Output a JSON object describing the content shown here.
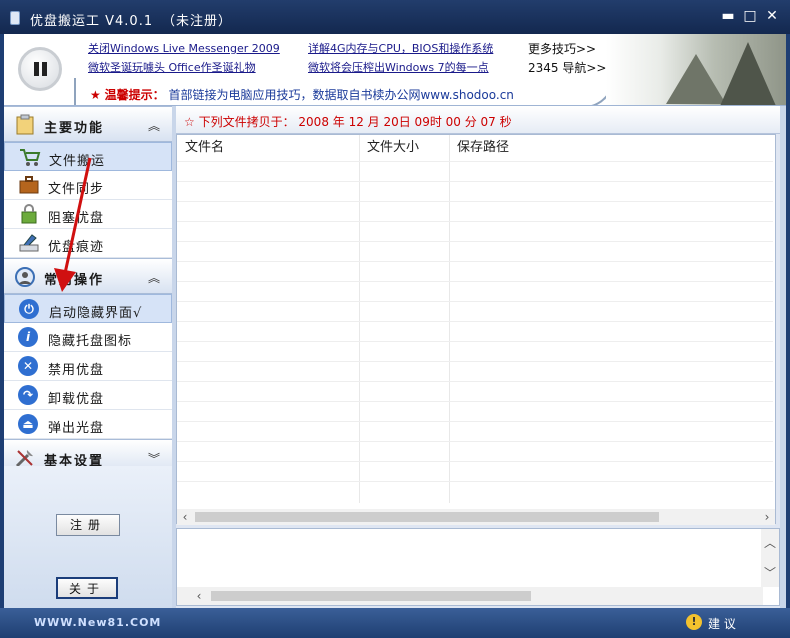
{
  "window": {
    "title": "优盘搬运工 V4.0.1",
    "registration_status": "（未注册）",
    "controls": {
      "minimize": "▬",
      "maximize": "□",
      "close": "✕"
    }
  },
  "banner": {
    "links_col1": [
      "关闭Windows Live Messenger 2009",
      "微软圣诞玩噱头 Office作圣诞礼物"
    ],
    "links_col2": [
      "详解4G内存与CPU，BIOS和操作系统",
      "微软将会压榨出Windows 7的每一点"
    ],
    "links_col3": [
      "更多技巧>>",
      "2345 导航>>"
    ],
    "tip_star": "★",
    "tip_label": "温馨提示：",
    "tip_text": "首部链接为电脑应用技巧，数据取自书椟办公网www.shodoo.cn"
  },
  "sidebar": {
    "section_main": {
      "label": "主要功能",
      "chevron": "︽"
    },
    "main_items": [
      "文件搬运",
      "文件同步",
      "阻塞优盘",
      "优盘痕迹"
    ],
    "section_ops": {
      "label": "常用操作",
      "chevron": "︽"
    },
    "ops_items": [
      "启动隐藏界面√",
      "隐藏托盘图标",
      "禁用优盘",
      "卸载优盘",
      "弹出光盘"
    ],
    "section_settings": {
      "label": "基本设置",
      "chevron": "︾"
    },
    "register_button": "注册",
    "about_button": "关于"
  },
  "main": {
    "status_star": "☆",
    "status_text": "下列文件拷贝于： 2008 年 12 月 20日 09时 00 分 07 秒",
    "columns": [
      "文件名",
      "文件大小",
      "保存路径"
    ]
  },
  "footer": {
    "site": "WWW.New81.COM",
    "suggestion": "建 议",
    "warn_glyph": "!"
  },
  "colors": {
    "accent": "#c00000",
    "frame": "#1e3e73",
    "selection": "#d6e3f7"
  }
}
